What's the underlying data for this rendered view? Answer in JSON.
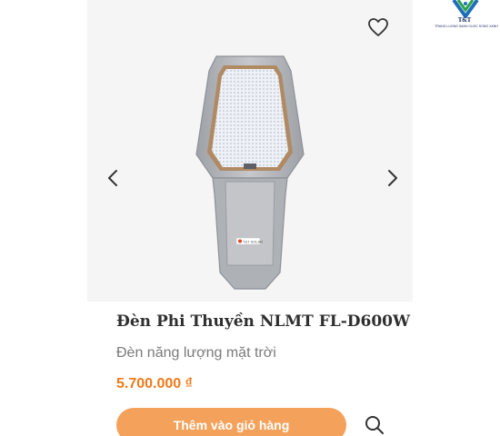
{
  "brand": {
    "name": "T&T",
    "slogan": "TRANG LUONG SANH CUOC SONG XANH"
  },
  "product": {
    "title": "Đèn Phi Thuyền NLMT FL-D600W",
    "subtitle": "Đèn năng lượng mặt trời",
    "price": "5.700.000 ₫",
    "badge_text": "T&T SOLAR"
  },
  "actions": {
    "add_to_cart_label": "Thêm vào giỏ hàng"
  },
  "icons": {
    "wishlist": "heart-icon",
    "prev": "chevron-left-icon",
    "next": "chevron-right-icon",
    "search": "search-icon"
  },
  "colors": {
    "price": "#f07a1a",
    "button": "#f4a25b",
    "brand": "#20306a"
  }
}
